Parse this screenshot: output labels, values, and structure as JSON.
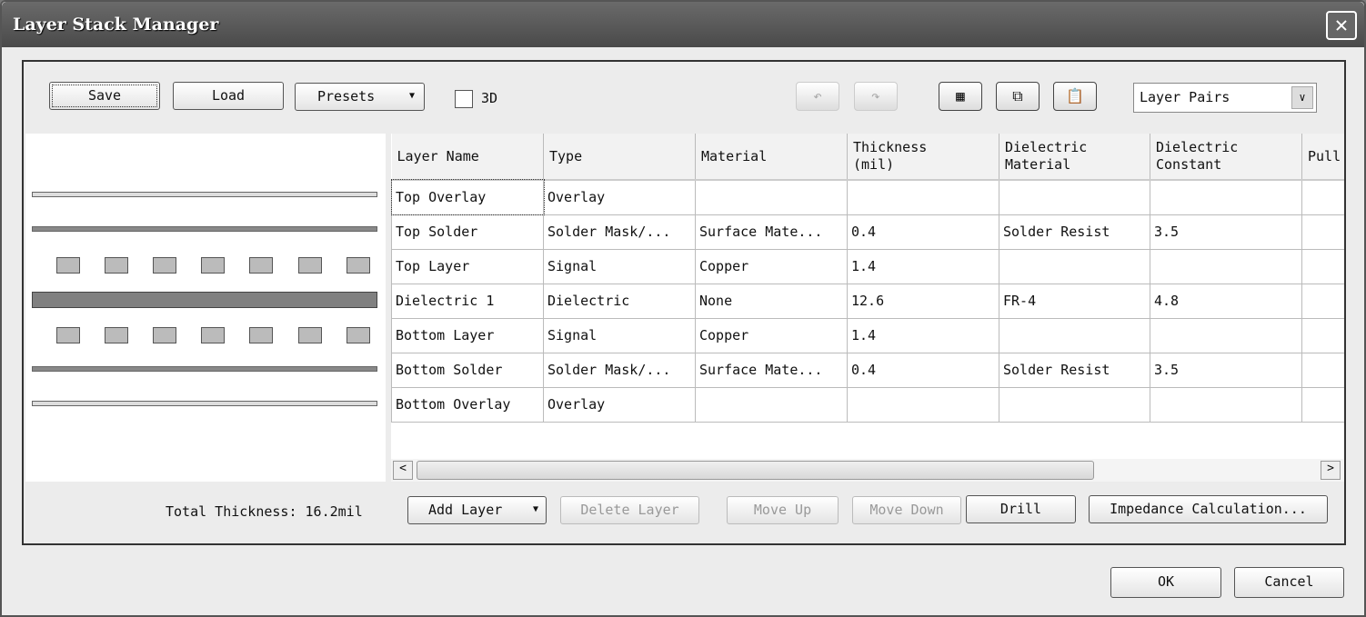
{
  "window": {
    "title": "Layer Stack Manager",
    "close_icon": "close-icon"
  },
  "toolbar": {
    "save": "Save",
    "load": "Load",
    "presets": "Presets",
    "checkbox_3d": "3D",
    "checkbox_3d_checked": false,
    "undo_icon": "undo-icon",
    "redo_icon": "redo-icon",
    "stack_icon": "layer-image-icon",
    "copy_icon": "copy-icon",
    "paste_icon": "paste-icon",
    "view_select": "Layer Pairs"
  },
  "table": {
    "columns": [
      "Layer Name",
      "Type",
      "Material",
      "Thickness\n(mil)",
      "Dielectric\nMaterial",
      "Dielectric\nConstant",
      "Pull"
    ],
    "rows": [
      [
        "Top Overlay",
        "Overlay",
        "",
        "",
        "",
        "",
        ""
      ],
      [
        "Top Solder",
        "Solder Mask/...",
        "Surface Mate...",
        "0.4",
        "Solder Resist",
        "3.5",
        ""
      ],
      [
        "Top Layer",
        "Signal",
        "Copper",
        "1.4",
        "",
        "",
        ""
      ],
      [
        "Dielectric 1",
        "Dielectric",
        "None",
        "12.6",
        "FR-4",
        "4.8",
        ""
      ],
      [
        "Bottom Layer",
        "Signal",
        "Copper",
        "1.4",
        "",
        "",
        ""
      ],
      [
        "Bottom Solder",
        "Solder Mask/...",
        "Surface Mate...",
        "0.4",
        "Solder Resist",
        "3.5",
        ""
      ],
      [
        "Bottom Overlay",
        "Overlay",
        "",
        "",
        "",
        "",
        ""
      ]
    ]
  },
  "bottom": {
    "total_thickness": "Total Thickness: 16.2mil",
    "add_layer": "Add Layer",
    "delete_layer": "Delete Layer",
    "move_up": "Move Up",
    "move_down": "Move Down",
    "drill": "Drill",
    "impedance": "Impedance Calculation..."
  },
  "dialog": {
    "ok": "OK",
    "cancel": "Cancel"
  }
}
